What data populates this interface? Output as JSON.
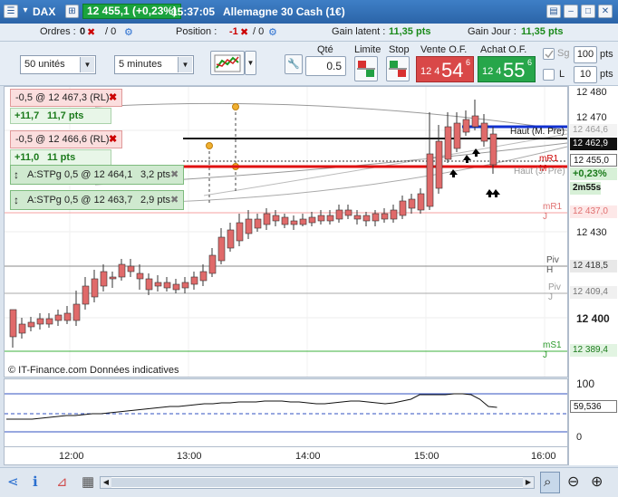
{
  "header": {
    "instrument": "DAX",
    "price_badge": "12 455,1 (+0,23%)",
    "time": "15:37:05",
    "title": "Allemagne 30 Cash (1€)"
  },
  "status_row": {
    "orders_label": "Ordres :",
    "orders_value": "0",
    "orders_sep": "/ 0",
    "position_label": "Position :",
    "position_value": "-1",
    "position_sep": "/ 0",
    "latent_label": "Gain latent :",
    "latent_value": "11,35 pts",
    "day_label": "Gain Jour :",
    "day_value": "11,35 pts"
  },
  "toolbar": {
    "units_select": "50 unités",
    "period_select": "5 minutes",
    "qty_label": "Qté",
    "qty_value": "0.5",
    "limit_label": "Limite",
    "stop_label": "Stop",
    "sell_label": "Vente O.F.",
    "sell_small": "12 4",
    "sell_big": "54",
    "sell_dec": "6",
    "buy_label": "Achat O.F.",
    "buy_small": "12 4",
    "buy_big": "55",
    "buy_dec": "6",
    "sg_label": "Sg",
    "l_label": "L",
    "pts_value": "100",
    "pts_label": "pts",
    "pts_value2": "10",
    "pts_label2": "pts"
  },
  "orders": [
    {
      "text": "-0,5 @ 12 467,3 (RL)"
    },
    {
      "text": "-0,5 @ 12 466,6 (RL)"
    }
  ],
  "gains": [
    {
      "a": "+11,7",
      "b": "11,7 pts"
    },
    {
      "a": "+11,0",
      "b": "11 pts"
    }
  ],
  "stops": [
    {
      "text": "A:STPg  0,5 @ 12 464,1",
      "pts": "3,2 pts"
    },
    {
      "text": "A:STPg  0,5 @ 12 463,7",
      "pts": "2,9 pts"
    }
  ],
  "chart": {
    "watermark": "© IT-Finance.com  Données indicatives",
    "level_labels": {
      "haut_m": "Haut (M. Pre)",
      "mr1m": "mR1 M",
      "haut_j": "Haut (J. Pre)",
      "mr1j": "mR1 J",
      "piv_h": "Piv H",
      "piv_j": "Piv J",
      "ms1j": "mS1 J"
    },
    "y_ticks": [
      "12 480",
      "12 470",
      "12 430",
      "12 400"
    ],
    "price_tags": {
      "p1": "12 464,6",
      "p2": "12 462,9",
      "p3": "12 455,0",
      "p4": "+0,23%",
      "p5": "2m55s",
      "p6": "12 437,0",
      "p7": "12 418,5",
      "p8": "12 409,4",
      "p9": "12 389,4"
    },
    "ind_ticks": [
      "100",
      "59,536",
      "0"
    ],
    "x_ticks": [
      "12:00",
      "13:00",
      "14:00",
      "15:00",
      "16:00"
    ]
  },
  "colors": {
    "up": "#3cbc3c",
    "down": "#e06a6a",
    "red_line": "#e01010",
    "blue_line": "#1030d0"
  }
}
